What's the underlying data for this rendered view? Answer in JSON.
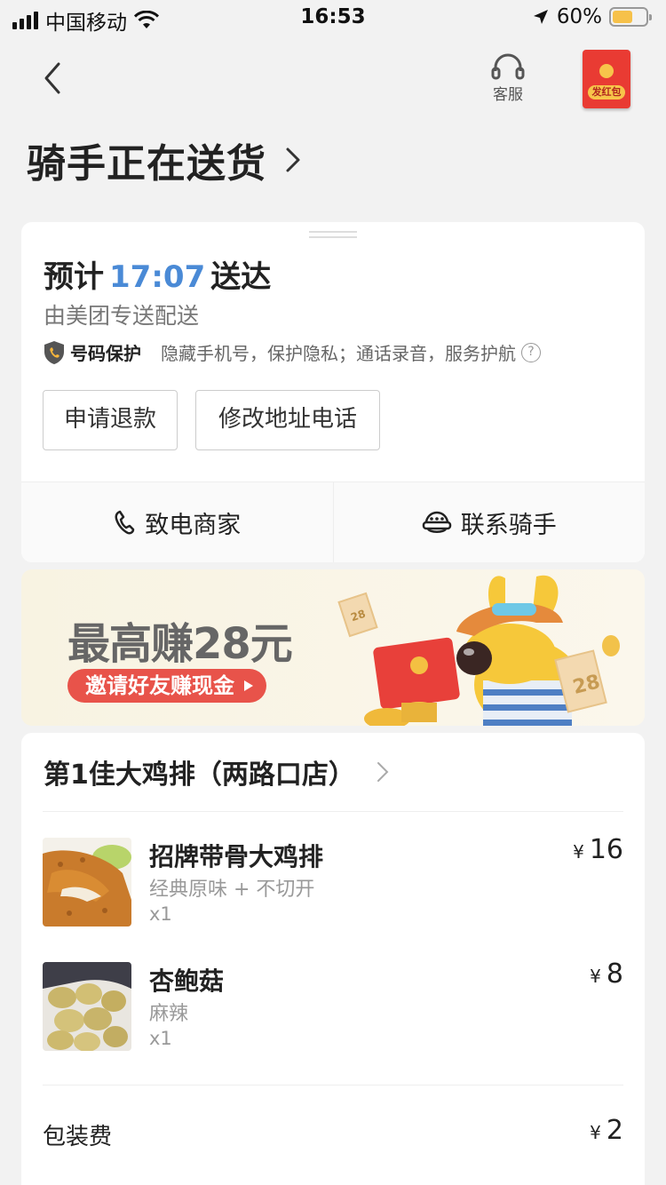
{
  "status_bar": {
    "carrier": "中国移动",
    "time": "16:53",
    "battery": "60%"
  },
  "nav": {
    "service_label": "客服",
    "redpack_label": "发红包"
  },
  "page_title": "骑手正在送货",
  "delivery": {
    "eta_prefix": "预计",
    "eta_time": "17:07",
    "eta_suffix": "送达",
    "provider": "由美团专送配送",
    "protect_title": "号码保护",
    "protect_desc": "隐藏手机号，保护隐私；通话录音，服务护航",
    "refund_button": "申请退款",
    "modify_button": "修改地址电话",
    "call_merchant": "致电商家",
    "contact_rider": "联系骑手"
  },
  "banner": {
    "headline": "最高赚28元",
    "cta": "邀请好友赚现金",
    "ticket_number": "28"
  },
  "order": {
    "shop_name": "第1佳大鸡排（两路口店）",
    "currency": "¥",
    "items": [
      {
        "name": "招牌带骨大鸡排",
        "spec": "经典原味 + 不切开",
        "qty": "x1",
        "price": "16"
      },
      {
        "name": "杏鲍菇",
        "spec": "麻辣",
        "qty": "x1",
        "price": "8"
      }
    ],
    "fees": [
      {
        "label": "包装费",
        "price": "2"
      }
    ]
  },
  "colors": {
    "accent_blue": "#4a8ad6",
    "red": "#e93b33",
    "cta_red": "#e8534a"
  }
}
